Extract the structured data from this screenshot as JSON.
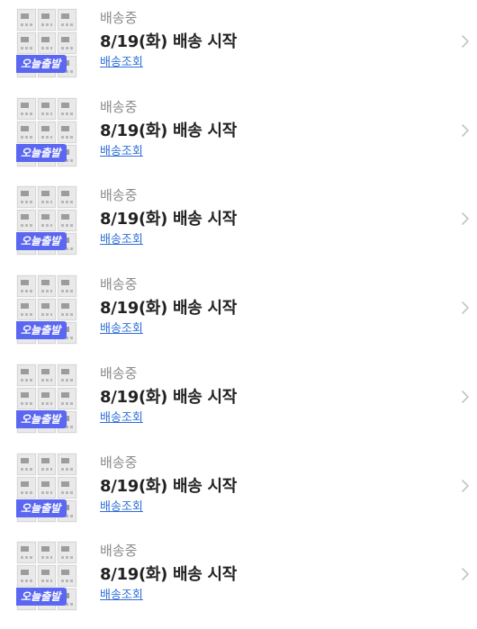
{
  "orders": [
    {
      "thumbnail": "product-thumbnail",
      "badge": "오늘출발",
      "status": "배송중",
      "title": "8/19(화) 배송 시작",
      "link": "배송조회",
      "chevron": "chevron-right-icon"
    },
    {
      "thumbnail": "product-thumbnail",
      "badge": "오늘출발",
      "status": "배송중",
      "title": "8/19(화) 배송 시작",
      "link": "배송조회",
      "chevron": "chevron-right-icon"
    },
    {
      "thumbnail": "product-thumbnail",
      "badge": "오늘출발",
      "status": "배송중",
      "title": "8/19(화) 배송 시작",
      "link": "배송조회",
      "chevron": "chevron-right-icon"
    },
    {
      "thumbnail": "product-thumbnail",
      "badge": "오늘출발",
      "status": "배송중",
      "title": "8/19(화) 배송 시작",
      "link": "배송조회",
      "chevron": "chevron-right-icon"
    },
    {
      "thumbnail": "product-thumbnail",
      "badge": "오늘출발",
      "status": "배송중",
      "title": "8/19(화) 배송 시작",
      "link": "배송조회",
      "chevron": "chevron-right-icon"
    },
    {
      "thumbnail": "product-thumbnail",
      "badge": "오늘출발",
      "status": "배송중",
      "title": "8/19(화) 배송 시작",
      "link": "배송조회",
      "chevron": "chevron-right-icon"
    },
    {
      "thumbnail": "product-thumbnail",
      "badge": "오늘출발",
      "status": "배송중",
      "title": "8/19(화) 배송 시작",
      "link": "배송조회",
      "chevron": "chevron-right-icon"
    }
  ],
  "colors": {
    "badge": "#5b67f0",
    "status": "#8b8b8b",
    "title": "#222222",
    "link": "#2f6fd8",
    "chevron": "#c4c4c4"
  }
}
